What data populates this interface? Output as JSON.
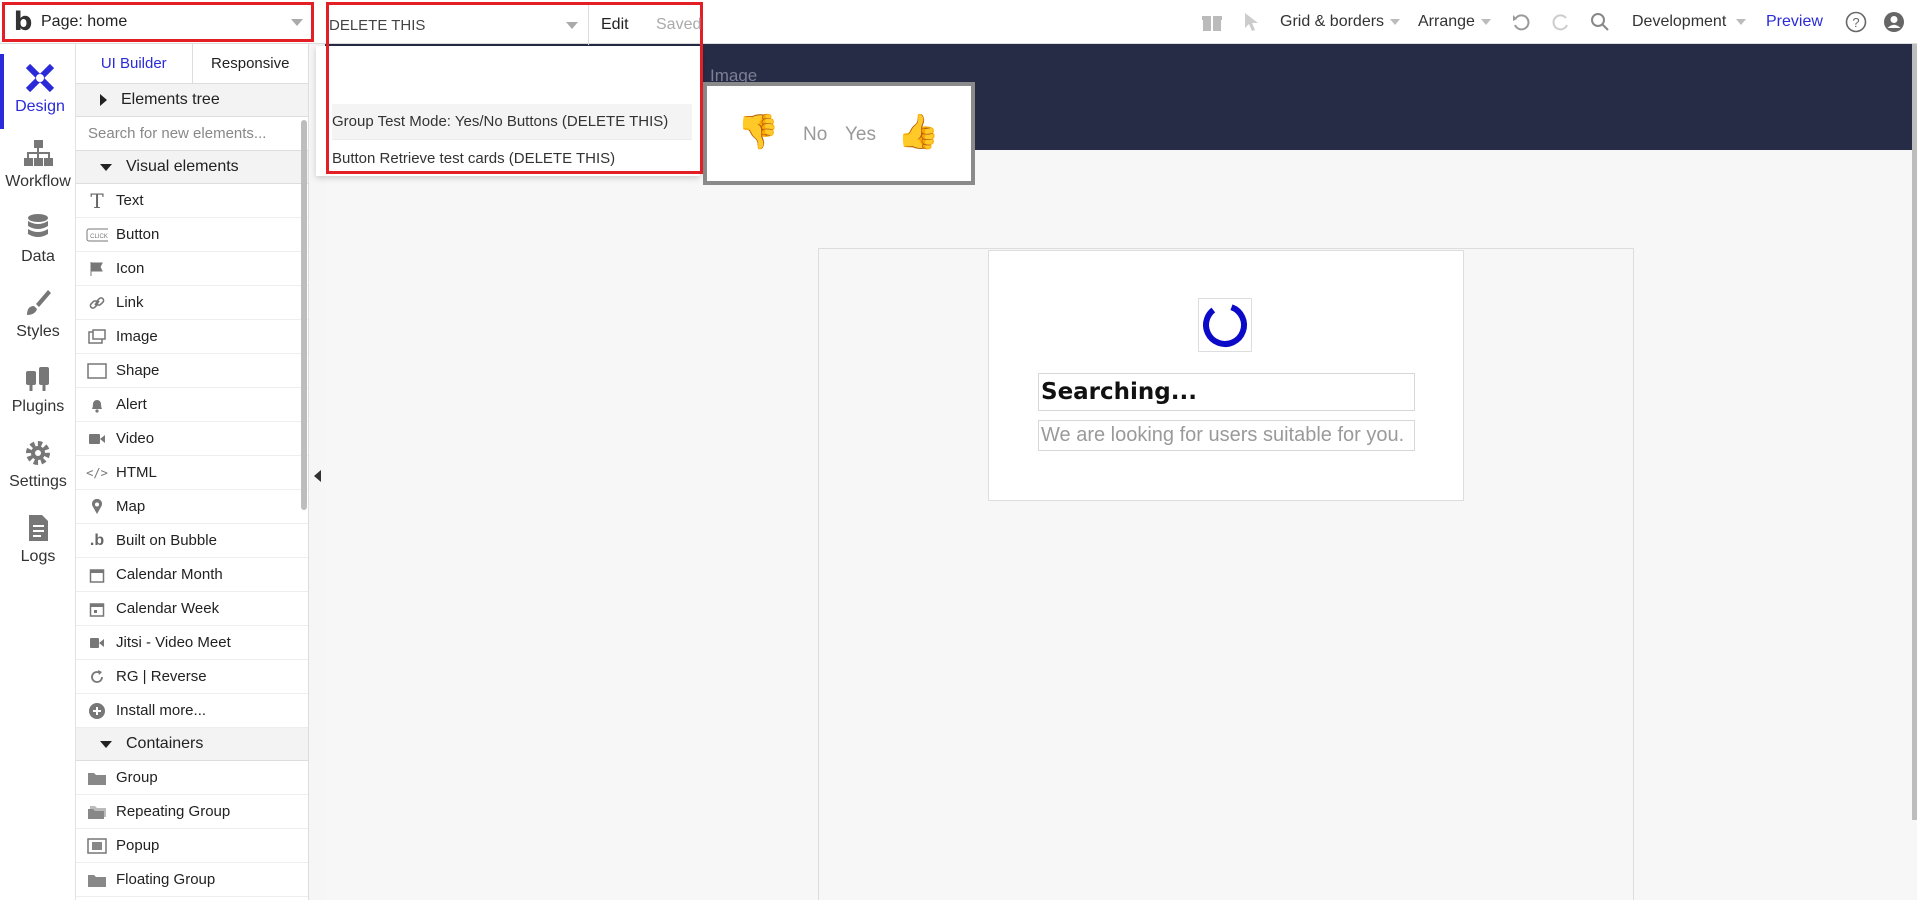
{
  "topbar": {
    "page_selector": "Page: home",
    "element_selector": "DELETE THIS",
    "edit": "Edit",
    "saved": "Saved",
    "grid_borders": "Grid & borders",
    "arrange": "Arrange",
    "development": "Development",
    "preview": "Preview"
  },
  "element_dropdown": {
    "items": [
      "Group Test Mode: Yes/No Buttons (DELETE THIS)",
      "Button Retrieve test cards  (DELETE THIS)"
    ]
  },
  "rail": {
    "items": [
      {
        "label": "Design"
      },
      {
        "label": "Workflow"
      },
      {
        "label": "Data"
      },
      {
        "label": "Styles"
      },
      {
        "label": "Plugins"
      },
      {
        "label": "Settings"
      },
      {
        "label": "Logs"
      }
    ]
  },
  "panel": {
    "tabs": [
      "UI Builder",
      "Responsive"
    ],
    "elements_tree": "Elements tree",
    "search_placeholder": "Search for new elements...",
    "visual_elements_header": "Visual elements",
    "visual_elements": [
      "Text",
      "Button",
      "Icon",
      "Link",
      "Image",
      "Shape",
      "Alert",
      "Video",
      "HTML",
      "Map",
      "Built on Bubble",
      "Calendar Month",
      "Calendar Week",
      "Jitsi - Video Meet",
      "RG | Reverse",
      "Install more..."
    ],
    "containers_header": "Containers",
    "containers": [
      "Group",
      "Repeating Group",
      "Popup",
      "Floating Group"
    ]
  },
  "canvas": {
    "header_label": "Image",
    "no": "No",
    "yes": "Yes",
    "searching_title": "Searching...",
    "searching_subtitle": "We are looking for users suitable for you."
  },
  "colors": {
    "accent": "#2a2ad8",
    "highlight": "#e31e24",
    "header_band": "#262b46",
    "loader": "#0a0ac8"
  }
}
